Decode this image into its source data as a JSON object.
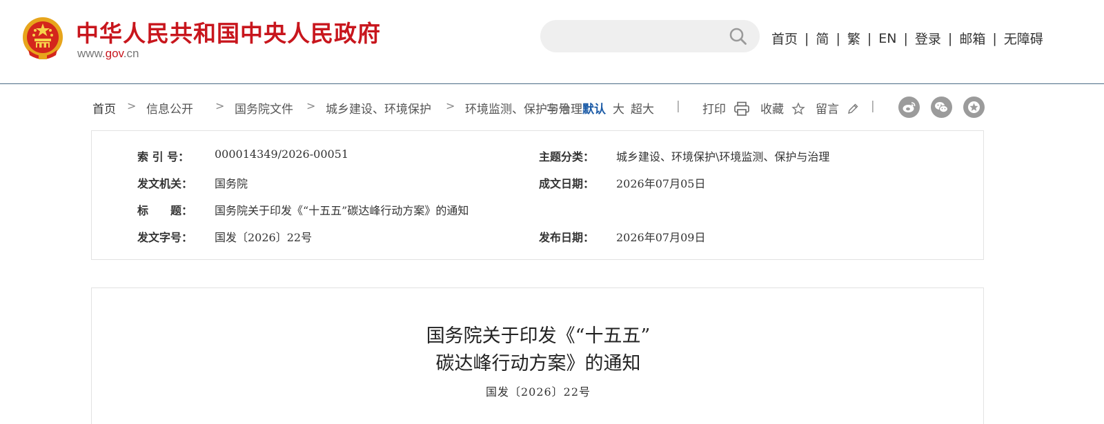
{
  "header": {
    "site_title": "中华人民共和国中央人民政府",
    "site_domain_prefix": "www.",
    "site_domain_accent": "gov",
    "site_domain_suffix": ".cn",
    "search_placeholder": "",
    "nav": [
      "首页",
      "简",
      "繁",
      "EN",
      "登录",
      "邮箱",
      "无障碍"
    ],
    "nav_separator": "|",
    "brand_color": "#c8161d"
  },
  "breadcrumb": {
    "items": [
      "首页",
      "信息公开",
      "国务院文件",
      "城乡建设、环境保护",
      "环境监测、保护与治理"
    ],
    "separator": ">"
  },
  "font_size_tools": {
    "overlap_text": "字号",
    "default_label": "默认",
    "large_label": "大",
    "xlarge_label": "超大"
  },
  "actions": {
    "print_label": "打印",
    "favorite_label": "收藏",
    "comment_label": "留言",
    "separator": "|"
  },
  "social_icons": [
    "weibo-icon",
    "wechat-icon",
    "favorite-star-icon"
  ],
  "info": {
    "index_label": "索 引 号：",
    "index_value": "000014349/2026-00051",
    "topic_label": "主题分类：",
    "topic_value": "城乡建设、环境保护\\环境监测、保护与治理",
    "issuer_label": "发文机关：",
    "issuer_value": "国务院",
    "created_label": "成文日期：",
    "created_value": "2026年07月05日",
    "title_label": "标　　题：",
    "title_value": "国务院关于印发《“十五五”碳达峰行动方案》的通知",
    "docno_label": "发文字号：",
    "docno_value": "国发〔2026〕22号",
    "published_label": "发布日期：",
    "published_value": "2026年07月09日"
  },
  "document": {
    "title_line1": "国务院关于印发《“十五五”",
    "title_line2": "碳达峰行动方案》的通知",
    "number": "国发〔2026〕22号"
  }
}
